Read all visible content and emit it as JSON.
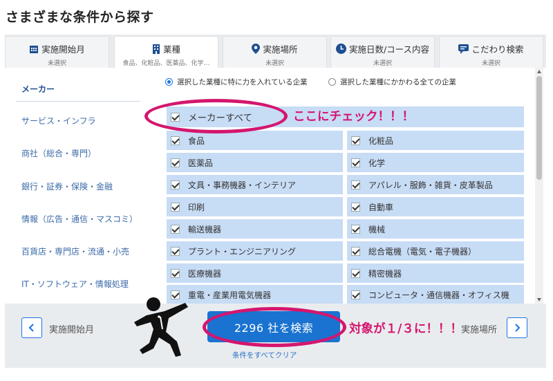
{
  "page": {
    "title": "さまざまな条件から探す"
  },
  "tabs": [
    {
      "label": "実施開始月",
      "sub": "未選択",
      "icon": "calendar-icon"
    },
    {
      "label": "業種",
      "sub": "食品、化粧品、医薬品、化学…",
      "icon": "building-icon"
    },
    {
      "label": "実施場所",
      "sub": "未選択",
      "icon": "location-pin-icon"
    },
    {
      "label": "実施日数/コース内容",
      "sub": "未選択",
      "icon": "clock-icon"
    },
    {
      "label": "こだわり検索",
      "sub": "未選択",
      "icon": "chat-icon"
    }
  ],
  "categories": [
    "メーカー",
    "サービス・インフラ",
    "商社（総合・専門）",
    "銀行・証券・保険・金融",
    "情報（広告・通信・マスコミ）",
    "百貨店・専門店・流通・小売",
    "IT・ソフトウェア・情報処理"
  ],
  "radio": {
    "option1": "選択した業種に特に力を入れている企業",
    "option2": "選択した業種にかかわる全ての企業"
  },
  "check_all": "メーカーすべて",
  "checkboxes": {
    "left": [
      "食品",
      "医薬品",
      "文具・事務機器・インテリア",
      "印刷",
      "輸送機器",
      "プラント・エンジニアリング",
      "医療機器",
      "重電・産業用電気機器"
    ],
    "right": [
      "化粧品",
      "化学",
      "アパレル・服飾・雑貨・皮革製品",
      "自動車",
      "機械",
      "総合電機（電気・電子機器）",
      "精密機器",
      "コンピュータ・通信機器・オフィス機"
    ]
  },
  "footer": {
    "prev_label": "実施開始月",
    "next_label": "実施場所",
    "search_button": "2296 社を検索",
    "clear_link": "条件をすべてクリア"
  },
  "annotations": {
    "check_here": "ここにチェック！！！",
    "result_note": "対象が１/３に！！！"
  },
  "colors": {
    "accent": "#1a73d0",
    "annotation": "#d4166e",
    "checkbox_bg": "#c7dcf5"
  }
}
